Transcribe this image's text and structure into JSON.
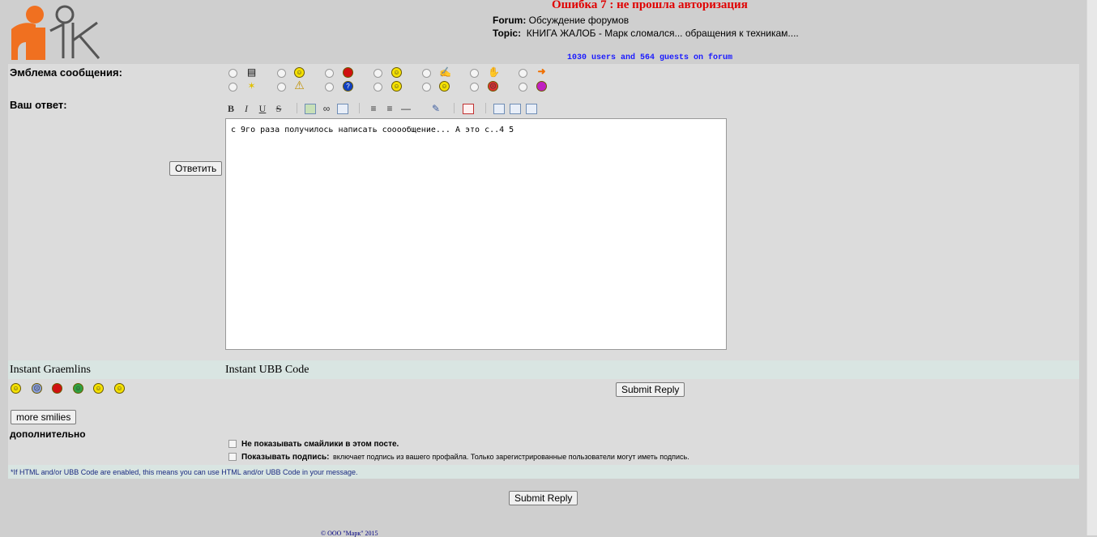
{
  "header": {
    "error_title": "Ошибка 7 : не прошла авторизация",
    "forum_label": "Forum:",
    "forum_value": "Обсуждение форумов",
    "topic_label": "Topic:",
    "topic_value": "КНИГА ЖАЛОБ - Марк сломался... обращения к техникам....",
    "online": "1030 users and 564 guests on forum"
  },
  "form": {
    "emblem_label": "Эмблема сообщения:",
    "reply_label": "Ваш ответ:",
    "reply_button": "Ответить",
    "message_text": "с 9го раза получилось написать сооообщение... А это с..4 5",
    "emblem_icons": [
      "phone-icon",
      "grin-icon",
      "angry-icon",
      "smile-icon",
      "hand-note-icon",
      "thumbsup-icon",
      "arrow-right-icon",
      "lightbulb-icon",
      "warning-icon",
      "question-icon",
      "cool-icon",
      "smile-icon",
      "frown-icon",
      "purple-icon"
    ],
    "toolbar": [
      "B",
      "I",
      "U",
      "S"
    ]
  },
  "graemlins": {
    "instant_graemlins": "Instant Graemlins",
    "instant_ubb": "Instant UBB Code",
    "submit_top": "Submit Reply",
    "more_smilies": "more smilies",
    "additional": "дополнительно",
    "opt1_label": "Не показывать смайлики в этом посте.",
    "opt2_label": "Показывать подпись:",
    "opt2_desc": "включает подпись из вашего профайла. Только зарегистрированные пользователи могут иметь подпись.",
    "note": "*If HTML and/or UBB Code are enabled, this means you can use HTML and/or UBB Code in your message."
  },
  "bottom": {
    "submit": "Submit Reply",
    "copyright": "© ООО \"Марк\" 2015"
  },
  "colors": {
    "error": "#e00000",
    "online": "#1a1aff",
    "logo_orange": "#f07020"
  }
}
